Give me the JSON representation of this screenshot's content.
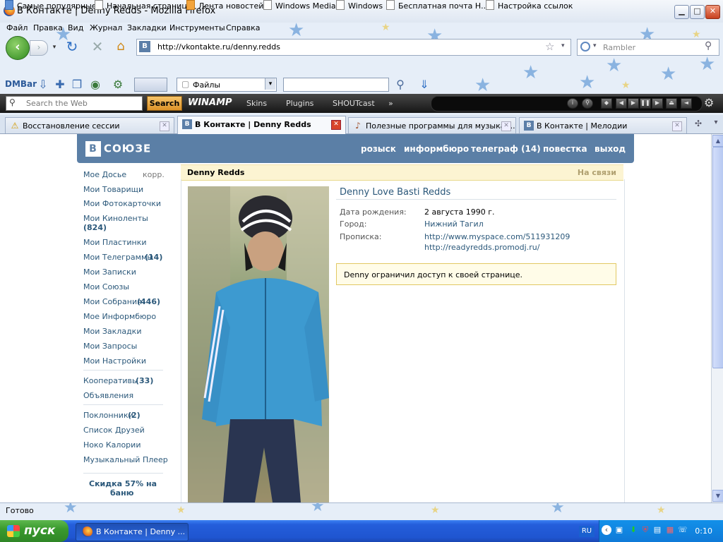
{
  "window": {
    "title": "В Контакте  |  Denny Redds - Mozilla Firefox",
    "min_icon": "minimize-icon",
    "max_icon": "maximize-icon",
    "close_icon": "close-icon"
  },
  "menu": [
    "Файл",
    "Правка",
    "Вид",
    "Журнал",
    "Закладки",
    "Инструменты",
    "Справка"
  ],
  "nav": {
    "url": "http://vkontakte.ru/denny.redds",
    "search_placeholder": "Rambler"
  },
  "bookmarks": [
    "Самые популярные",
    "Начальная страница",
    "Лента новостей",
    "Windows Media",
    "Windows",
    "Бесплатная почта Н...",
    "Настройка ссылок"
  ],
  "dmbar": {
    "label": "DMBar",
    "files_select": "Файлы"
  },
  "winamp": {
    "search_placeholder": "Search the Web",
    "search_button": "Search",
    "logo": "WINAMP",
    "menu": [
      "Skins",
      "Plugins",
      "SHOUTcast"
    ],
    "more": "»"
  },
  "tabs": [
    {
      "label": "Восстановление сессии",
      "active": false
    },
    {
      "label": "В Контакте  |  Denny Redds",
      "active": true
    },
    {
      "label": "Полезные программы для музыкан...",
      "active": false
    },
    {
      "label": "В Контакте | Мелодии",
      "active": false
    }
  ],
  "vk": {
    "logo_letter": "В",
    "logo_text": "СОЮЗЕ",
    "header_nav": [
      "розыск",
      "информбюро",
      "телеграф (14)",
      "повестка",
      "выход"
    ],
    "left_menu": {
      "dossier": "Мое Досье",
      "edit": "корр.",
      "items": [
        "Мои Товарищи",
        "Мои Фотокарточки",
        "Мои Киноленты",
        "(824)",
        "Мои Пластинки",
        "Мои Телеграммы",
        "(14)",
        "Мои Записки",
        "Мои Союзы",
        "Мои Собрания",
        "(446)",
        "Мое Информбюро",
        "Мои Закладки",
        "Мои Запросы",
        "Мои Настройки"
      ],
      "group2": [
        "Кооперативы",
        "(33)",
        "Объявления"
      ],
      "group3": [
        "Поклонники",
        "(2)",
        "Список Друзей",
        "Ноко Калории",
        "Музыкальный Плеер"
      ],
      "promo": [
        "Скидка 57% на",
        "баню"
      ]
    },
    "profile": {
      "name": "Denny Redds",
      "status": "На связи",
      "full_name": "Denny Love Basti Redds",
      "fields": [
        {
          "label": "Дата рождения:",
          "value": "2 августа 1990 г."
        },
        {
          "label": "Город:",
          "value": "Нижний Тагил"
        },
        {
          "label": "Прописка:",
          "value": "http://www.myspace.com/511931209"
        }
      ],
      "link2": "http://readyredds.promodj.ru/",
      "notice": "Denny ограничил доступ к своей странице."
    }
  },
  "status_bar": "Готово",
  "taskbar": {
    "start": "пуск",
    "item": "В Контакте | Denny ...",
    "lang": "RU",
    "clock": "0:10"
  }
}
